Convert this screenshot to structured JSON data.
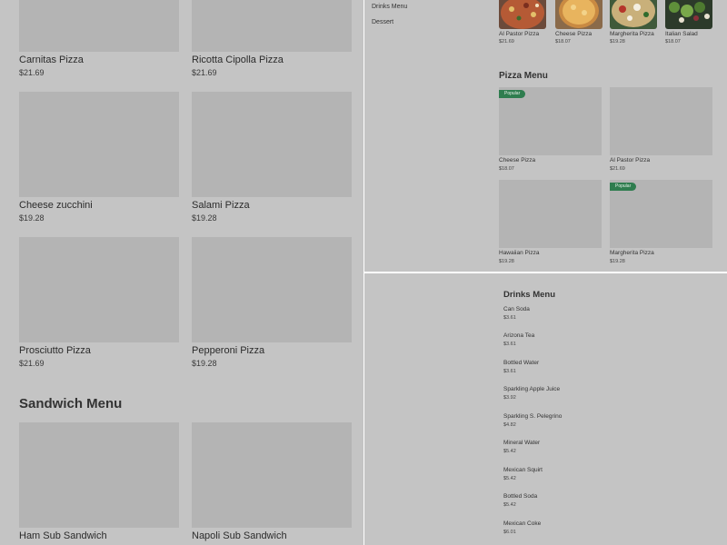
{
  "left_pane": {
    "items": [
      {
        "name": "Carnitas Pizza",
        "price": "$21.69"
      },
      {
        "name": "Ricotta Cipolla Pizza",
        "price": "$21.69"
      },
      {
        "name": "Cheese zucchini",
        "price": "$19.28"
      },
      {
        "name": "Salami Pizza",
        "price": "$19.28"
      },
      {
        "name": "Prosciutto Pizza",
        "price": "$21.69"
      },
      {
        "name": "Pepperoni Pizza",
        "price": "$19.28"
      }
    ],
    "sandwich_section": {
      "title": "Sandwich Menu",
      "items": [
        {
          "name": "Ham Sub Sandwich"
        },
        {
          "name": "Napoli Sub Sandwich"
        }
      ]
    }
  },
  "top_right_pane": {
    "nav": [
      "Drinks Menu",
      "Dessert"
    ],
    "featured": [
      {
        "name": "Al Pastor Pizza",
        "price": "$21.69",
        "icon": "al-pastor-photo"
      },
      {
        "name": "Cheese Pizza",
        "price": "$18.07",
        "icon": "cheese-pizza-photo"
      },
      {
        "name": "Margherita Pizza",
        "price": "$19.28",
        "icon": "margherita-photo"
      },
      {
        "name": "Italian Salad",
        "price": "$18.07",
        "icon": "salad-photo"
      }
    ],
    "pizza_menu": {
      "title": "Pizza Menu",
      "items": [
        {
          "name": "Cheese Pizza",
          "price": "$18.07",
          "badge": "Popular"
        },
        {
          "name": "Al Pastor Pizza",
          "price": "$21.69",
          "badge": ""
        },
        {
          "name": "Hawaiian Pizza",
          "price": "$19.28",
          "badge": ""
        },
        {
          "name": "Margherita Pizza",
          "price": "$19.28",
          "badge": "Popular"
        }
      ]
    }
  },
  "bottom_right_pane": {
    "title": "Drinks Menu",
    "items": [
      {
        "name": "Can Soda",
        "price": "$3.61"
      },
      {
        "name": "Arizona Tea",
        "price": "$3.61"
      },
      {
        "name": "Bottled Water",
        "price": "$3.61"
      },
      {
        "name": "Sparkling Apple Juice",
        "price": "$3.92"
      },
      {
        "name": "Sparkling S. Pelegrino",
        "price": "$4.82"
      },
      {
        "name": "Mineral Water",
        "price": "$5.42"
      },
      {
        "name": "Mexican Squirt",
        "price": "$5.42"
      },
      {
        "name": "Bottled Soda",
        "price": "$5.42"
      },
      {
        "name": "Mexican Coke",
        "price": "$6.01"
      }
    ]
  },
  "colors": {
    "background": "#c4c4c4",
    "placeholder": "#b4b4b4",
    "badge": "#2f7d4f",
    "divider": "#ffffff"
  }
}
